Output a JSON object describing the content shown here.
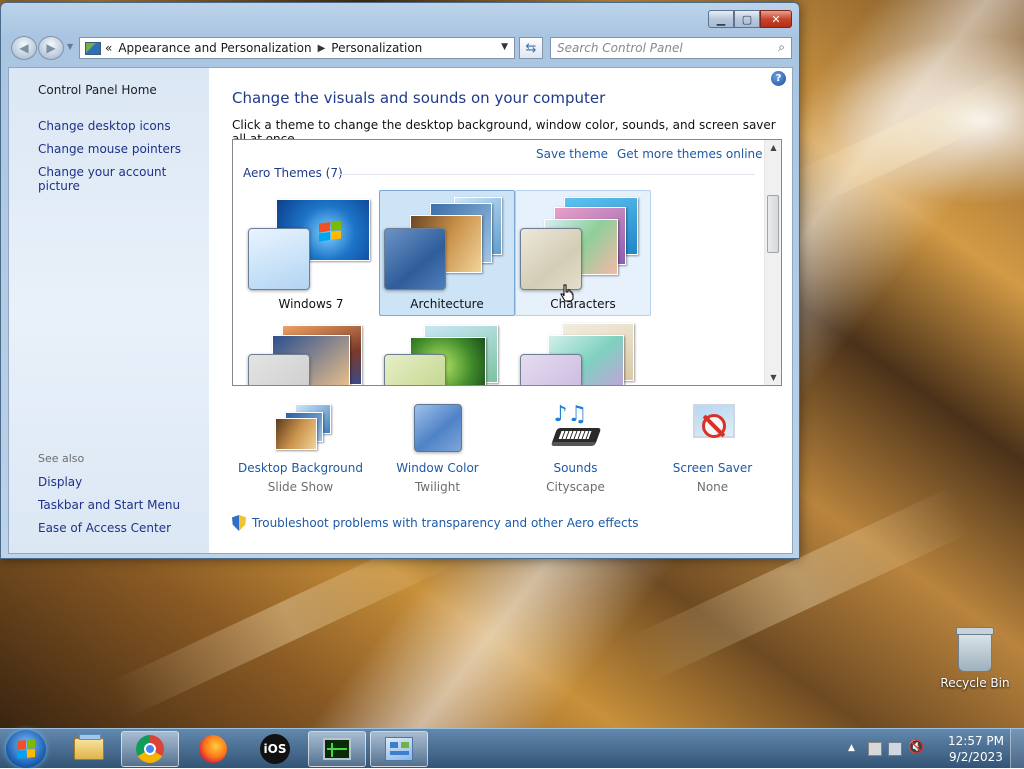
{
  "window": {
    "breadcrumb": [
      "Appearance and Personalization",
      "Personalization"
    ],
    "breadcrumb_prefix": "«",
    "search_placeholder": "Search Control Panel"
  },
  "sidebar": {
    "home": "Control Panel Home",
    "links": [
      "Change desktop icons",
      "Change mouse pointers",
      "Change your account picture"
    ],
    "see_also_label": "See also",
    "see_also": [
      "Display",
      "Taskbar and Start Menu",
      "Ease of Access Center"
    ]
  },
  "main": {
    "title": "Change the visuals and sounds on your computer",
    "subtitle": "Click a theme to change the desktop background, window color, sounds, and screen saver all at once.",
    "save_theme": "Save theme",
    "get_more": "Get more themes online",
    "group_title": "Aero Themes (7)",
    "themes": [
      {
        "name": "Windows 7",
        "state": "normal"
      },
      {
        "name": "Architecture",
        "state": "selected"
      },
      {
        "name": "Characters",
        "state": "hover"
      }
    ],
    "tools": [
      {
        "label": "Desktop Background",
        "value": "Slide Show"
      },
      {
        "label": "Window Color",
        "value": "Twilight"
      },
      {
        "label": "Sounds",
        "value": "Cityscape"
      },
      {
        "label": "Screen Saver",
        "value": "None"
      }
    ],
    "troubleshoot": "Troubleshoot problems with transparency and other Aero effects"
  },
  "desktop": {
    "recycle_bin": "Recycle Bin"
  },
  "taskbar": {
    "apps": [
      "file-explorer",
      "chrome",
      "firefox",
      "ios",
      "task-manager",
      "control-panel"
    ],
    "time": "12:57 PM",
    "date": "9/2/2023"
  },
  "colors": {
    "link": "#1e5aa6",
    "title": "#1e3b8a",
    "selection": "#cde4f7"
  }
}
